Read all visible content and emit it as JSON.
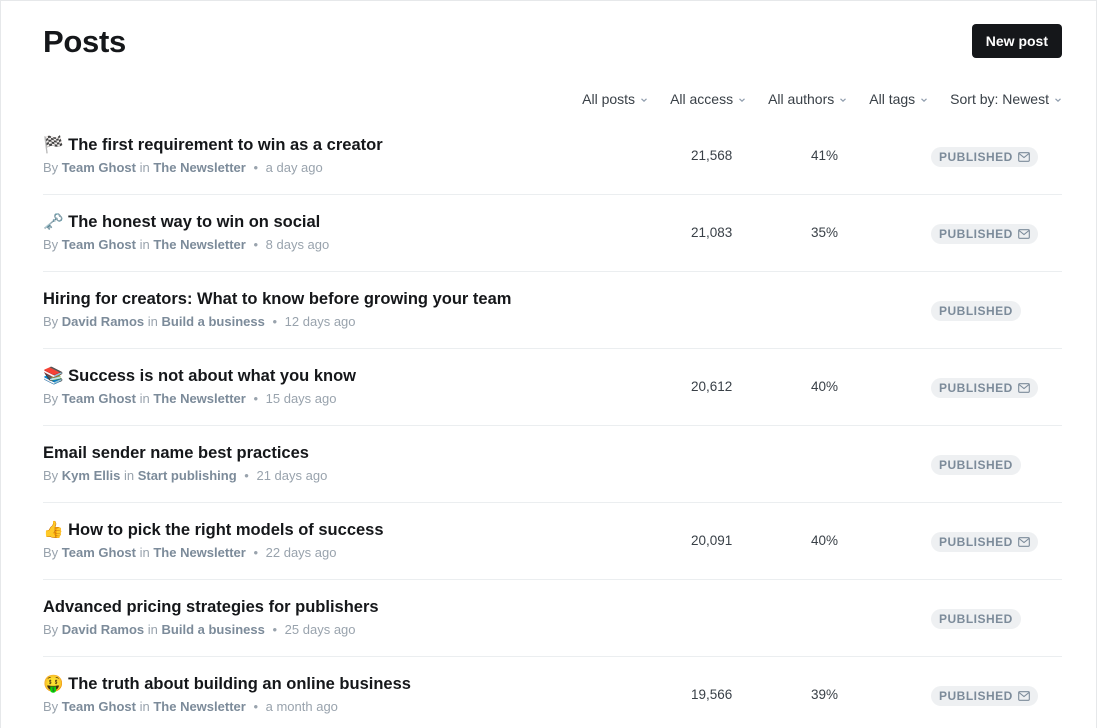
{
  "header": {
    "title": "Posts",
    "new_post_label": "New post"
  },
  "filters": [
    {
      "label": "All posts"
    },
    {
      "label": "All access"
    },
    {
      "label": "All authors"
    },
    {
      "label": "All tags"
    },
    {
      "label": "Sort by: Newest"
    }
  ],
  "posts": [
    {
      "title": "🏁 The first requirement to win as a creator",
      "by": "By",
      "author": "Team Ghost",
      "in": "in",
      "publication": "The Newsletter",
      "dot": "•",
      "age": "a day ago",
      "sends": "21,568",
      "rate": "41%",
      "status": "PUBLISHED",
      "emailed": true
    },
    {
      "title": "🗝️ The honest way to win on social",
      "by": "By",
      "author": "Team Ghost",
      "in": "in",
      "publication": "The Newsletter",
      "dot": "•",
      "age": "8 days ago",
      "sends": "21,083",
      "rate": "35%",
      "status": "PUBLISHED",
      "emailed": true
    },
    {
      "title": "Hiring for creators: What to know before growing your team",
      "by": "By",
      "author": "David Ramos",
      "in": "in",
      "publication": "Build a business",
      "dot": "•",
      "age": "12 days ago",
      "sends": "",
      "rate": "",
      "status": "PUBLISHED",
      "emailed": false
    },
    {
      "title": "📚 Success is not about what you know",
      "by": "By",
      "author": "Team Ghost",
      "in": "in",
      "publication": "The Newsletter",
      "dot": "•",
      "age": "15 days ago",
      "sends": "20,612",
      "rate": "40%",
      "status": "PUBLISHED",
      "emailed": true
    },
    {
      "title": "Email sender name best practices",
      "by": "By",
      "author": "Kym Ellis",
      "in": "in",
      "publication": "Start publishing",
      "dot": "•",
      "age": "21 days ago",
      "sends": "",
      "rate": "",
      "status": "PUBLISHED",
      "emailed": false
    },
    {
      "title": "👍 How to pick the right models of success",
      "by": "By",
      "author": "Team Ghost",
      "in": "in",
      "publication": "The Newsletter",
      "dot": "•",
      "age": "22 days ago",
      "sends": "20,091",
      "rate": "40%",
      "status": "PUBLISHED",
      "emailed": true
    },
    {
      "title": "Advanced pricing strategies for publishers",
      "by": "By",
      "author": "David Ramos",
      "in": "in",
      "publication": "Build a business",
      "dot": "•",
      "age": "25 days ago",
      "sends": "",
      "rate": "",
      "status": "PUBLISHED",
      "emailed": false
    },
    {
      "title": "🤑 The truth about building an online business",
      "by": "By",
      "author": "Team Ghost",
      "in": "in",
      "publication": "The Newsletter",
      "dot": "•",
      "age": "a month ago",
      "sends": "19,566",
      "rate": "39%",
      "status": "PUBLISHED",
      "emailed": true
    }
  ],
  "icons": {
    "filter_chevron": "chevron-down-icon",
    "status_mail": "mail-icon"
  },
  "colors": {
    "primary_button": "#15171a",
    "badge_bg": "#eef0f2",
    "badge_text": "#7c8b9a",
    "meta_text": "#99a3ad"
  }
}
